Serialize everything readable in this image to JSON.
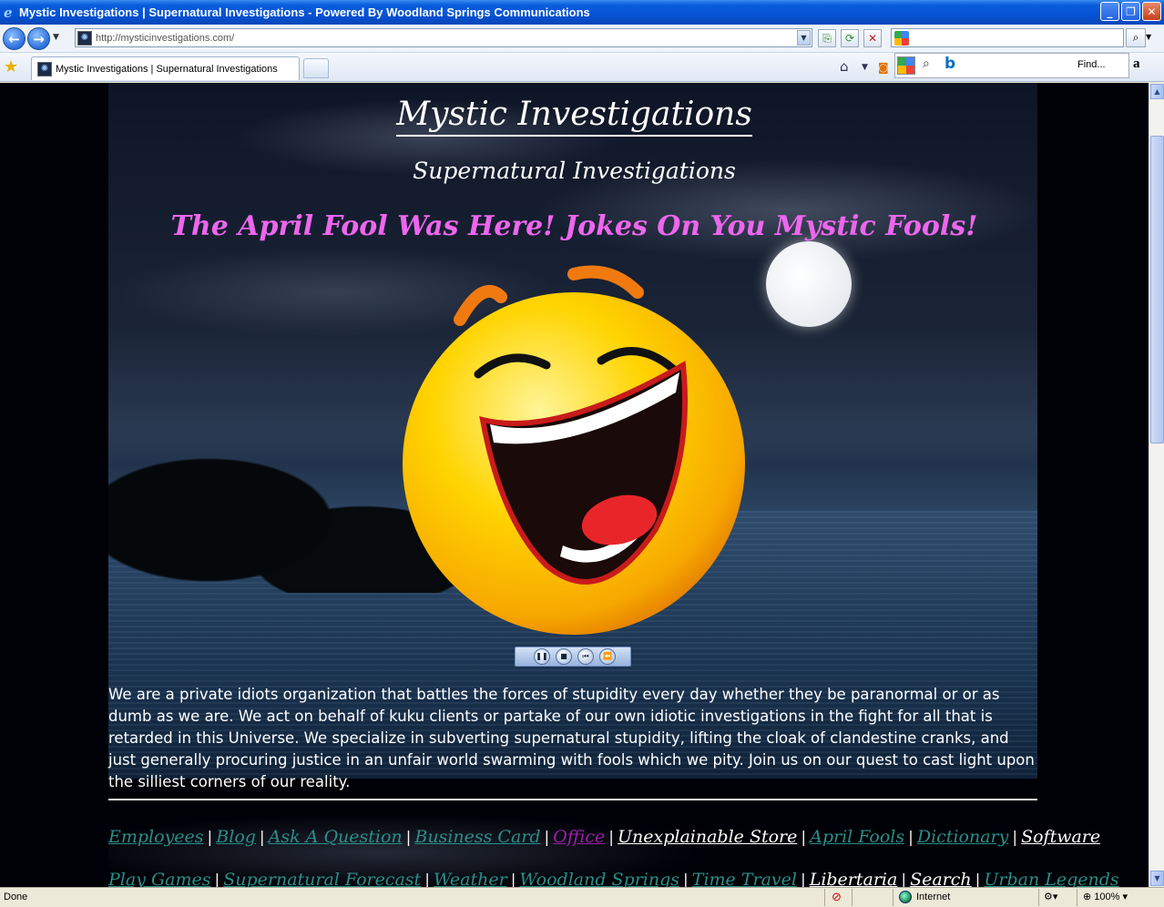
{
  "window": {
    "title": "Mystic Investigations | Supernatural Investigations - Powered By Woodland Springs Communications"
  },
  "address": {
    "url": "http://mysticinvestigations.com/"
  },
  "tab": {
    "label": "Mystic Investigations | Supernatural Investigations"
  },
  "toolbar": {
    "find_label": "Find..."
  },
  "page": {
    "title": "Mystic Investigations",
    "subtitle": "Supernatural Investigations",
    "announcement": "The April Fool Was Here! Jokes On You Mystic Fools!",
    "intro": "We are a private idiots organization that battles the forces of stupidity every day whether they be paranormal or or as dumb as we are.  We act on behalf of kuku clients or partake of our own idiotic investigations in the fight for all that is retarded in this Universe.  We specialize in subverting supernatural stupidity, lifting the cloak of clandestine cranks, and just generally procuring justice in an unfair world swarming with fools which we pity.  Join us on our quest to cast light upon the silliest corners of our reality.",
    "nav_row1": [
      {
        "label": "Employees",
        "color": "#2a8f88"
      },
      {
        "label": "Blog",
        "color": "#2a8f88"
      },
      {
        "label": "Ask A Question",
        "color": "#2a8f88"
      },
      {
        "label": "Business Card",
        "color": "#2a8f88"
      },
      {
        "label": "Office",
        "color": "#9c1fa8"
      },
      {
        "label": "Unexplainable Store",
        "color": "#ffffff"
      },
      {
        "label": "April Fools",
        "color": "#2a8f88"
      },
      {
        "label": "Dictionary",
        "color": "#2a8f88"
      },
      {
        "label": "Software",
        "color": "#ffffff"
      }
    ],
    "nav_row2": [
      {
        "label": "Play Games",
        "color": "#2a8f88"
      },
      {
        "label": "Supernatural Forecast",
        "color": "#2a8f88"
      },
      {
        "label": "Weather",
        "color": "#2a8f88"
      },
      {
        "label": "Woodland Springs",
        "color": "#2a8f88"
      },
      {
        "label": "Time Travel",
        "color": "#2a8f88"
      },
      {
        "label": "Libertaria",
        "color": "#ffffff"
      },
      {
        "label": "Search",
        "color": "#ffffff"
      },
      {
        "label": "Urban Legends",
        "color": "#2a8f88"
      }
    ]
  },
  "status": {
    "text": "Done",
    "zone": "Internet",
    "zoom": "100%"
  }
}
